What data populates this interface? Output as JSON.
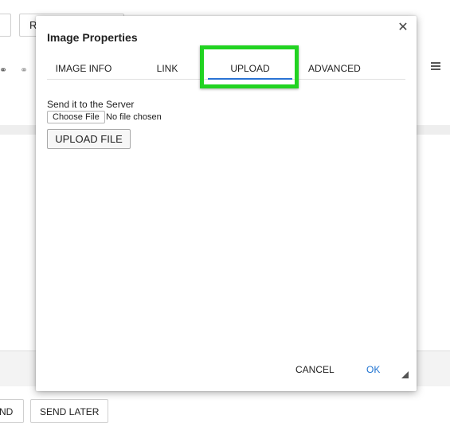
{
  "background": {
    "top_button_label": "R",
    "bottom_left_label": "ND",
    "send_later_label": "SEND LATER",
    "icons": {
      "link": "link-icon",
      "unlink": "unlink-icon",
      "menu": "hamburger-menu-icon"
    }
  },
  "dialog": {
    "title": "Image Properties",
    "close_glyph": "✕",
    "tabs": [
      {
        "label": "IMAGE INFO"
      },
      {
        "label": "LINK"
      },
      {
        "label": "UPLOAD"
      },
      {
        "label": "ADVANCED"
      }
    ],
    "active_tab": "UPLOAD",
    "upload": {
      "label": "Send it to the Server",
      "choose_file_label": "Choose File",
      "file_status": "No file chosen",
      "upload_button_label": "UPLOAD FILE"
    },
    "footer": {
      "cancel_label": "CANCEL",
      "ok_label": "OK"
    }
  },
  "colors": {
    "active_tab_underline": "#2a73d4",
    "highlight_box": "#21d321",
    "ok_text": "#1f73d1"
  }
}
